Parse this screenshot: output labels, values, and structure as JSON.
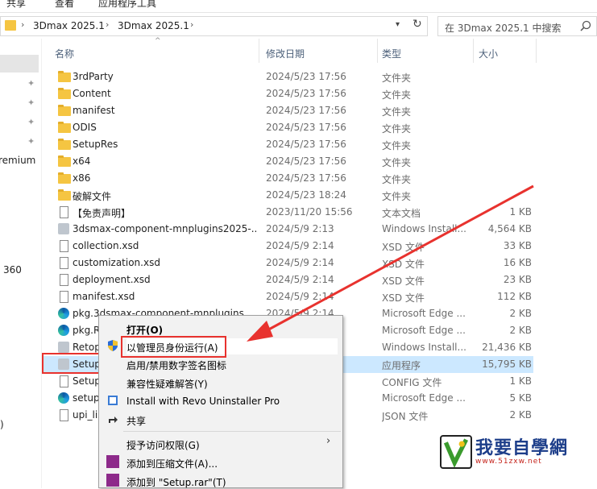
{
  "ribbon": {
    "tabs": [
      "共享",
      "查看",
      "应用程序工具"
    ]
  },
  "address": {
    "crumbs": [
      "3Dmax 2025.1",
      "3Dmax 2025.1"
    ]
  },
  "search": {
    "placeholder": "在 3Dmax 2025.1 中搜索"
  },
  "nav": {
    "items": [
      "remium",
      "360",
      ")"
    ]
  },
  "columns": {
    "name": "名称",
    "date": "修改日期",
    "type": "类型",
    "size": "大小"
  },
  "files": [
    {
      "name": "3rdParty",
      "date": "2024/5/23 17:56",
      "type": "文件夹",
      "size": "",
      "icon": "folder"
    },
    {
      "name": "Content",
      "date": "2024/5/23 17:56",
      "type": "文件夹",
      "size": "",
      "icon": "folder"
    },
    {
      "name": "manifest",
      "date": "2024/5/23 17:56",
      "type": "文件夹",
      "size": "",
      "icon": "folder"
    },
    {
      "name": "ODIS",
      "date": "2024/5/23 17:56",
      "type": "文件夹",
      "size": "",
      "icon": "folder"
    },
    {
      "name": "SetupRes",
      "date": "2024/5/23 17:56",
      "type": "文件夹",
      "size": "",
      "icon": "folder"
    },
    {
      "name": "x64",
      "date": "2024/5/23 17:56",
      "type": "文件夹",
      "size": "",
      "icon": "folder"
    },
    {
      "name": "x86",
      "date": "2024/5/23 17:56",
      "type": "文件夹",
      "size": "",
      "icon": "folder"
    },
    {
      "name": "破解文件",
      "date": "2024/5/23 18:24",
      "type": "文件夹",
      "size": "",
      "icon": "folder"
    },
    {
      "name": "【免责声明】",
      "date": "2023/11/20 15:56",
      "type": "文本文档",
      "size": "1 KB",
      "icon": "doc"
    },
    {
      "name": "3dsmax-component-mnplugins2025-...",
      "date": "2024/5/9 2:13",
      "type": "Windows Install...",
      "size": "4,564 KB",
      "icon": "msi"
    },
    {
      "name": "collection.xsd",
      "date": "2024/5/9 2:14",
      "type": "XSD 文件",
      "size": "33 KB",
      "icon": "doc"
    },
    {
      "name": "customization.xsd",
      "date": "2024/5/9 2:14",
      "type": "XSD 文件",
      "size": "16 KB",
      "icon": "doc"
    },
    {
      "name": "deployment.xsd",
      "date": "2024/5/9 2:14",
      "type": "XSD 文件",
      "size": "23 KB",
      "icon": "doc"
    },
    {
      "name": "manifest.xsd",
      "date": "2024/5/9 2:14",
      "type": "XSD 文件",
      "size": "112 KB",
      "icon": "doc"
    },
    {
      "name": "pkg.3dsmax-component-mnplugins...",
      "date": "2024/5/9 2:14",
      "type": "Microsoft Edge ...",
      "size": "2 KB",
      "icon": "edge"
    },
    {
      "name": "pkg.R",
      "date": "",
      "type": "Microsoft Edge ...",
      "size": "2 KB",
      "icon": "edge"
    },
    {
      "name": "Retop",
      "date": "",
      "type": "Windows Install...",
      "size": "21,436 KB",
      "icon": "msi"
    },
    {
      "name": "Setup",
      "date": "",
      "type": "应用程序",
      "size": "15,795 KB",
      "icon": "exe"
    },
    {
      "name": "Setup",
      "date": "",
      "type": "CONFIG 文件",
      "size": "1 KB",
      "icon": "doc"
    },
    {
      "name": "setup",
      "date": "",
      "type": "Microsoft Edge ...",
      "size": "5 KB",
      "icon": "edge"
    },
    {
      "name": "upi_lis",
      "date": "",
      "type": "JSON 文件",
      "size": "2 KB",
      "icon": "doc"
    }
  ],
  "menu": {
    "open": "打开(O)",
    "run_as_admin": "以管理员身份运行(A)",
    "sig_icon": "启用/禁用数字签名图标",
    "compat": "兼容性疑难解答(Y)",
    "revo": "Install with Revo Uninstaller Pro",
    "share": "共享",
    "grant": "授予访问权限(G)",
    "add_archive": "添加到压缩文件(A)...",
    "add_rar": "添加到 \"Setup.rar\"(T)"
  },
  "watermark": {
    "title": "我要自學網",
    "url": "www.51zxw.net"
  },
  "colors": {
    "selection": "#cce8ff",
    "annotation": "#e8322e"
  }
}
